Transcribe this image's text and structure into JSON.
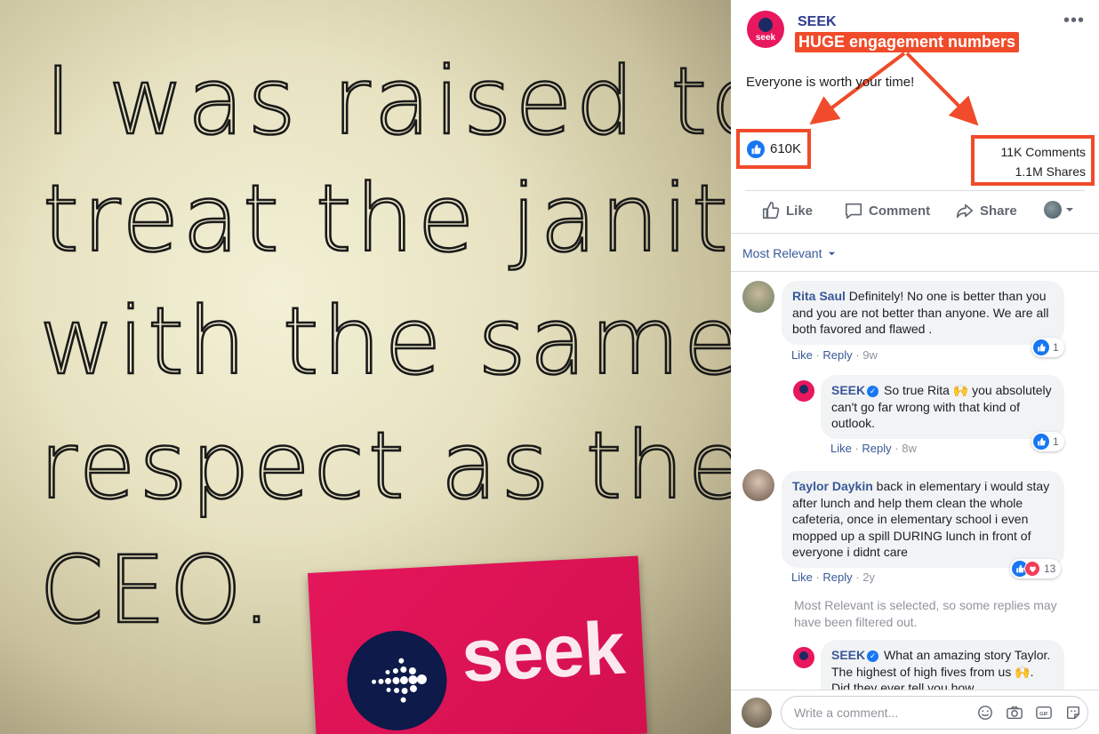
{
  "photo": {
    "note_lines": [
      "I was raised to",
      "treat the janitor",
      "with the same",
      "respect as the",
      "CEO."
    ],
    "card_wordmark": "seek"
  },
  "post": {
    "page_name": "SEEK",
    "avatar_text": "seek",
    "more_icon": "ellipsis-icon",
    "annotation": "HUGE engagement numbers",
    "text": "Everyone is worth your time!",
    "likes": "610K",
    "comments_count": "11K Comments",
    "shares_count": "1.1M Shares",
    "annotation_color": "#f04b2a"
  },
  "actions": {
    "like": "Like",
    "comment": "Comment",
    "share": "Share"
  },
  "filter": {
    "label": "Most Relevant"
  },
  "comments": [
    {
      "author": "Rita Saul",
      "text": "Definitely! No one is better than you and you are not better than anyone. We are all both favored and flawed .",
      "like": "Like",
      "reply": "Reply",
      "time": "9w",
      "reactions": "1"
    },
    {
      "author": "SEEK",
      "text": "So true Rita 🙌 you absolutely can't go far wrong with that kind of outlook.",
      "like": "Like",
      "reply": "Reply",
      "time": "8w",
      "reactions": "1"
    },
    {
      "author": "Taylor Daykin",
      "text": "back in elementary i would stay after lunch and help them clean the whole cafeteria, once in elementary school i even mopped up a spill DURING lunch in front of everyone i didnt care",
      "like": "Like",
      "reply": "Reply",
      "time": "2y",
      "reactions": "13"
    },
    {
      "author": "SEEK",
      "text": "What an amazing story Taylor. The highest of high fives from us 🙌. Did they ever tell you how"
    }
  ],
  "filtered_note": "Most Relevant is selected, so some replies may have been filtered out.",
  "composer": {
    "placeholder": "Write a comment..."
  },
  "colors": {
    "brand_pink": "#e8175e",
    "facebook_blue": "#1877f2",
    "link_blue": "#385898"
  }
}
